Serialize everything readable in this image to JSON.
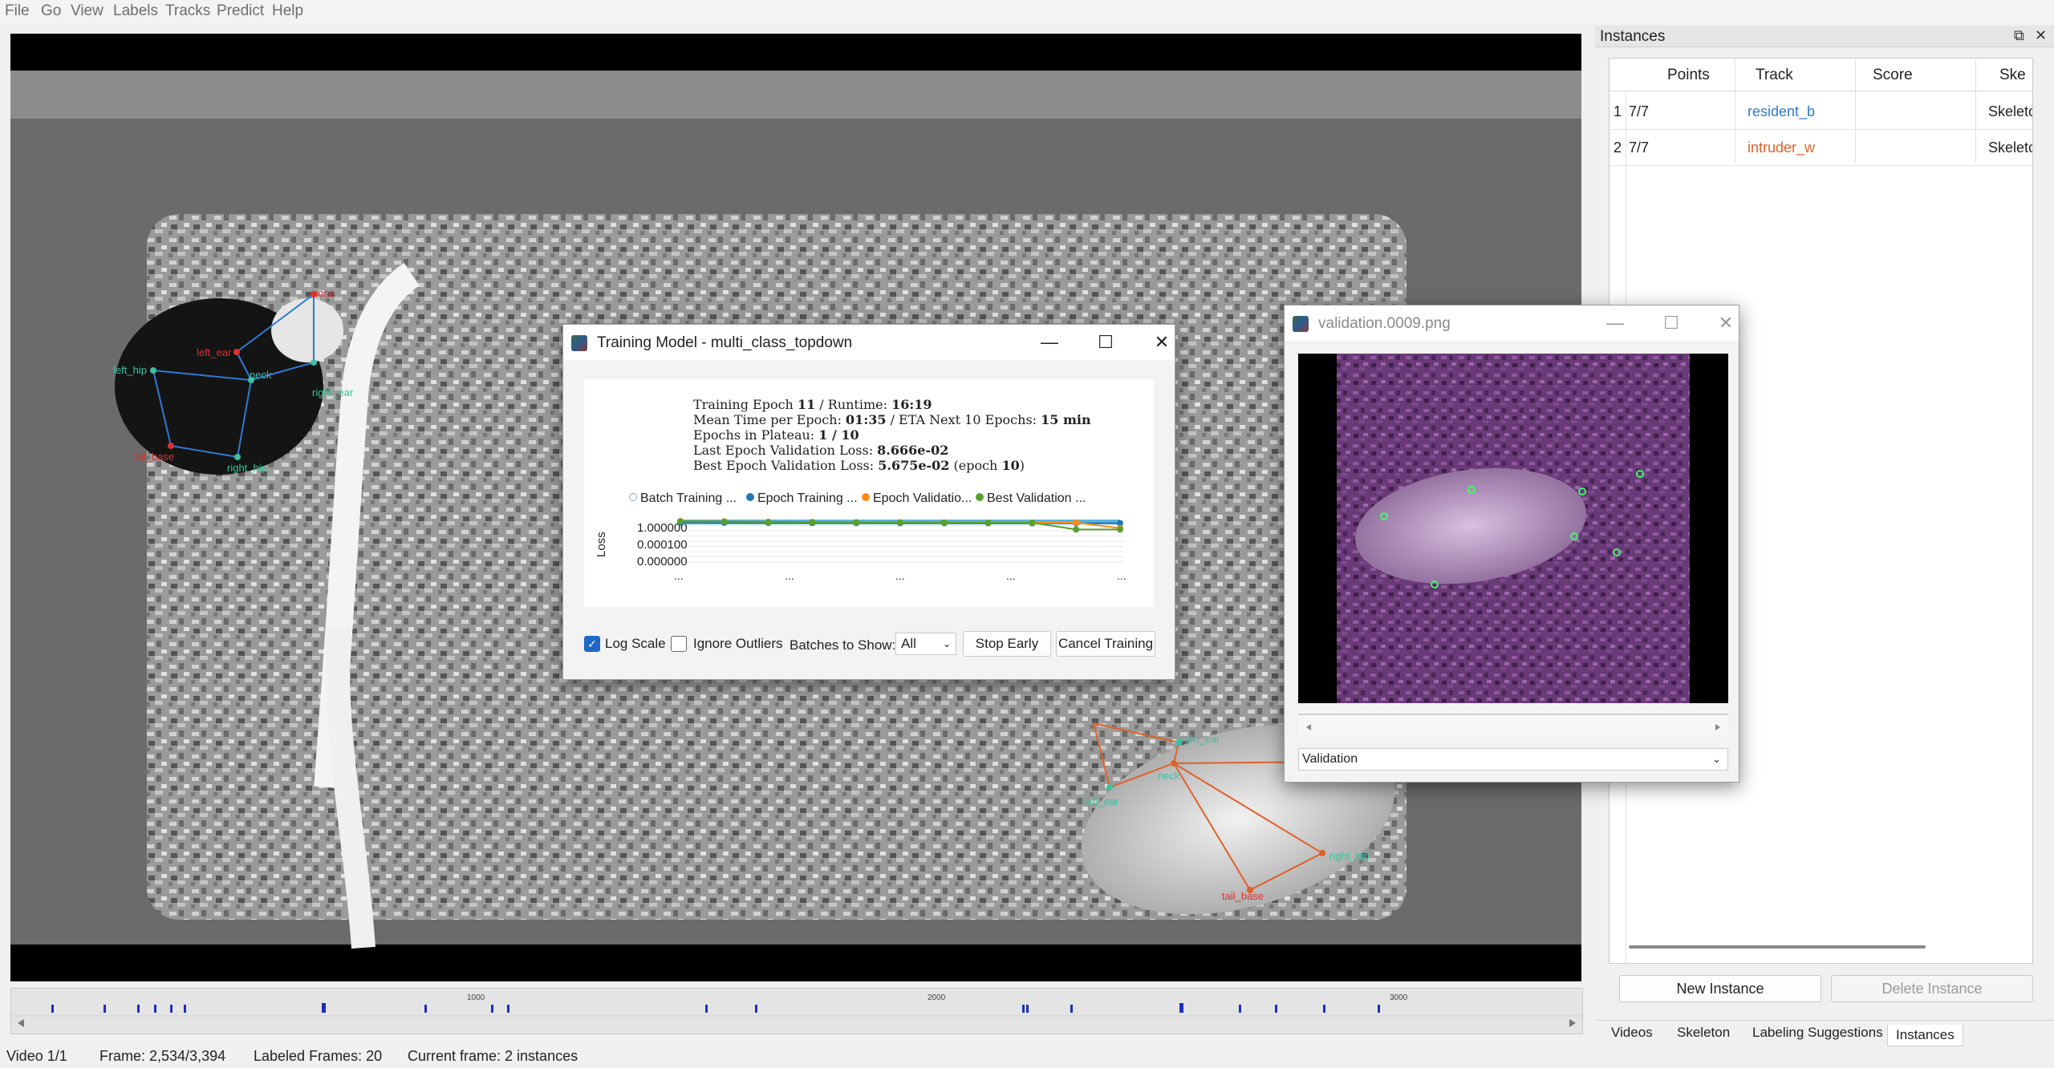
{
  "menu": [
    "File",
    "Go",
    "View",
    "Labels",
    "Tracks",
    "Predict",
    "Help"
  ],
  "colors": {
    "resident": "#2d7bd4",
    "intruder": "#e0602a",
    "node_label_resident": "#3ec0a0",
    "node_label_intruder": "#3ec0a0",
    "node_bad": "#e03030"
  },
  "video": {
    "resident_nodes": [
      {
        "name": "nose",
        "color": "red"
      },
      {
        "name": "left_ear",
        "color": "red"
      },
      {
        "name": "neck",
        "color": "teal"
      },
      {
        "name": "right_ear",
        "color": "teal"
      },
      {
        "name": "left_hip",
        "color": "teal"
      },
      {
        "name": "tail_base",
        "color": "red"
      },
      {
        "name": "right_hip",
        "color": "teal"
      }
    ],
    "intruder_nodes": [
      {
        "name": "right_ear",
        "color": "teal"
      },
      {
        "name": "left_ear",
        "color": "teal"
      },
      {
        "name": "neck",
        "color": "teal"
      },
      {
        "name": "right_hip",
        "color": "teal"
      },
      {
        "name": "tail_base",
        "color": "red"
      }
    ]
  },
  "timeline": {
    "ticks": [
      "1000",
      "2000",
      "3000"
    ],
    "total_frames": 3394,
    "current_frame": 2534
  },
  "status": {
    "video": "Video 1/1",
    "frame": "Frame: 2,534/3,394",
    "labeled": "Labeled Frames: 20",
    "current": "Current frame: 2 instances"
  },
  "instances": {
    "title": "Instances",
    "columns": [
      "Points",
      "Track",
      "Score",
      "Ske"
    ],
    "rows": [
      {
        "index": "1",
        "points": "7/7",
        "track": "resident_b",
        "score": "",
        "skeleton": "Skeleton"
      },
      {
        "index": "2",
        "points": "7/7",
        "track": "intruder_w",
        "score": "",
        "skeleton": "Skeleton"
      }
    ],
    "new_button": "New Instance",
    "delete_button": "Delete Instance",
    "tabs": [
      "Videos",
      "Skeleton",
      "Labeling Suggestions",
      "Instances"
    ]
  },
  "training": {
    "title": "Training Model - multi_class_topdown",
    "info": {
      "epoch_label": "Training Epoch ",
      "epoch": "11",
      "runtime_label": " / Runtime: ",
      "runtime": "16:19",
      "mean_label": "Mean Time per Epoch: ",
      "mean": "01:35",
      "eta_label": " / ETA Next 10 Epochs: ",
      "eta": "15 min",
      "plateau_label": "Epochs in Plateau: ",
      "plateau": "1 / 10",
      "last_label": "Last Epoch Validation Loss: ",
      "last": "8.666e-02",
      "best_label": "Best Epoch Validation Loss: ",
      "best": "5.675e-02",
      "best_epoch_pre": " (epoch ",
      "best_epoch": "10",
      "best_epoch_post": ")"
    },
    "legend": [
      {
        "name": "Batch Training ...",
        "color": "#7fb0c8"
      },
      {
        "name": "Epoch Training ...",
        "color": "#1f77b4"
      },
      {
        "name": "Epoch Validatio...",
        "color": "#ff8c1a"
      },
      {
        "name": "Best Validation ...",
        "color": "#5aa02c"
      }
    ],
    "ylabel": "Loss",
    "yticks": [
      "1.000000",
      "0.000100",
      "0.000000"
    ],
    "xticks": [
      "...",
      "...",
      "...",
      "...",
      "..."
    ],
    "log_scale_label": "Log Scale",
    "log_scale_checked": true,
    "ignore_outliers_label": "Ignore Outliers",
    "ignore_outliers_checked": false,
    "batches_label": "Batches to Show:",
    "batches_value": "All",
    "stop_button": "Stop Early",
    "cancel_button": "Cancel Training"
  },
  "chart_data": {
    "type": "line",
    "title": "",
    "xlabel": "",
    "ylabel": "Loss",
    "log_scale": true,
    "x": [
      1,
      2,
      3,
      4,
      5,
      6,
      7,
      8,
      9,
      10,
      11
    ],
    "series": [
      {
        "name": "Epoch Training ...",
        "values": [
          0.6,
          0.55,
          0.52,
          0.5,
          0.49,
          0.48,
          0.47,
          0.47,
          0.46,
          0.46,
          0.45
        ]
      },
      {
        "name": "Epoch Validatio...",
        "values": [
          0.9,
          0.8,
          0.7,
          0.65,
          0.62,
          0.6,
          0.58,
          0.56,
          0.55,
          0.57,
          0.087
        ]
      },
      {
        "name": "Best Validation ...",
        "values": [
          0.9,
          0.8,
          0.7,
          0.65,
          0.62,
          0.6,
          0.58,
          0.56,
          0.55,
          0.057,
          0.057
        ]
      }
    ]
  },
  "validation": {
    "title": "validation.0009.png",
    "dropdown": "Validation"
  }
}
